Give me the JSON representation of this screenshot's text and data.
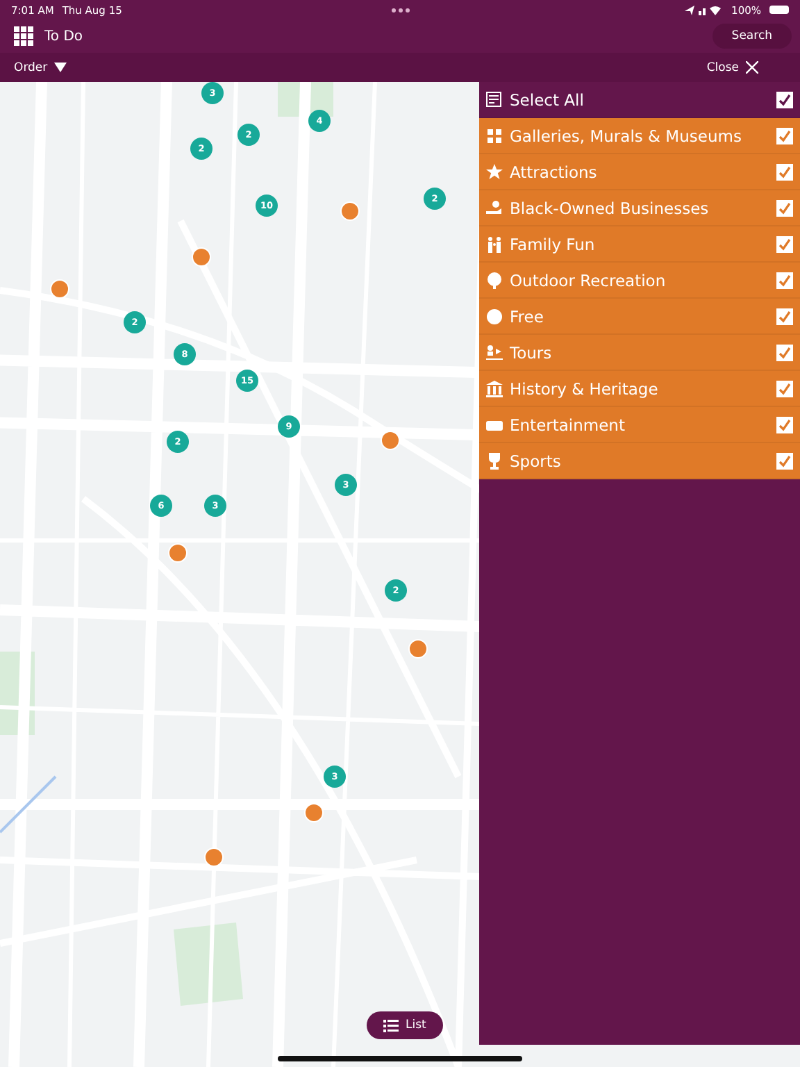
{
  "status_bar": {
    "time": "7:01 AM",
    "date": "Thu Aug 15",
    "battery": "100%"
  },
  "nav_bar": {
    "title": "To Do",
    "search_button": "Search"
  },
  "toolbar": {
    "order": "Order",
    "close": "Close"
  },
  "map": {
    "kind": "picture",
    "clusters": [
      "3",
      "4",
      "2",
      "2",
      "2",
      "10",
      "2",
      "8",
      "15",
      "9",
      "2",
      "6",
      "3",
      "3",
      "2",
      "3"
    ],
    "list_button": "List"
  },
  "filter_panel": {
    "select_all": {
      "label": "Select All",
      "checked": true
    },
    "categories": [
      {
        "label": "Galleries, Murals & Museums",
        "checked": true
      },
      {
        "label": "Attractions",
        "checked": true
      },
      {
        "label": "Black-Owned Businesses",
        "checked": true
      },
      {
        "label": "Family Fun",
        "checked": true
      },
      {
        "label": "Outdoor Recreation",
        "checked": true
      },
      {
        "label": "Free",
        "checked": true
      },
      {
        "label": "Tours",
        "checked": true
      },
      {
        "label": "History & Heritage",
        "checked": true
      },
      {
        "label": "Entertainment",
        "checked": true
      },
      {
        "label": "Sports",
        "checked": true
      }
    ]
  }
}
